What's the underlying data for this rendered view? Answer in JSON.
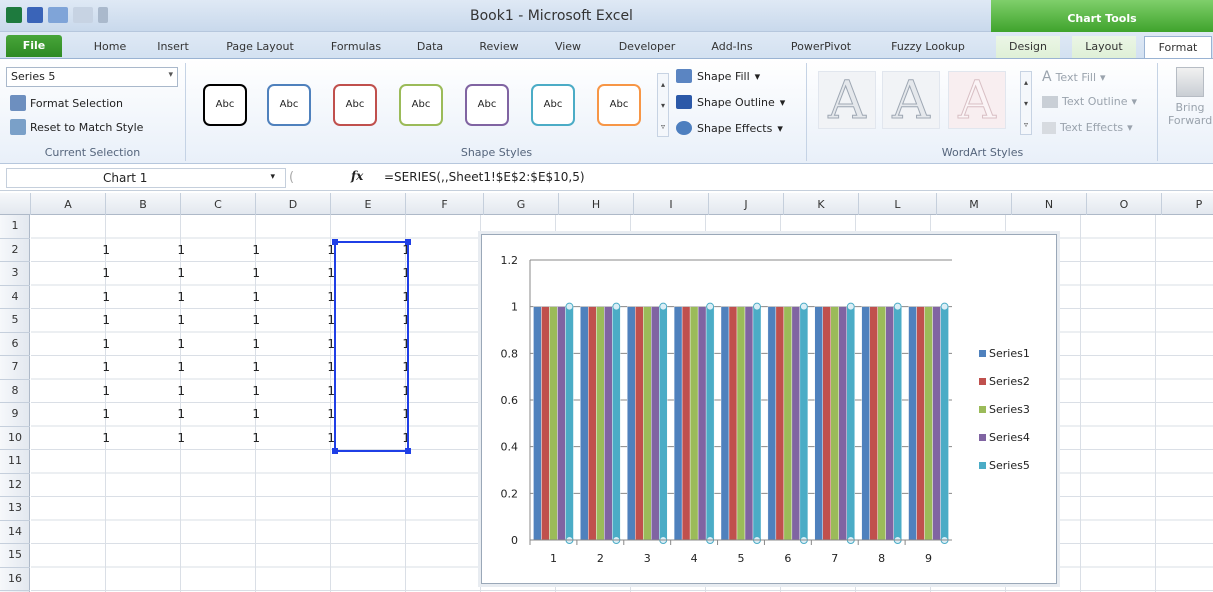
{
  "window": {
    "title": "Book1 - Microsoft Excel",
    "context_tab_group": "Chart Tools"
  },
  "tabs": [
    {
      "label": "File"
    },
    {
      "label": "Home"
    },
    {
      "label": "Insert"
    },
    {
      "label": "Page Layout"
    },
    {
      "label": "Formulas"
    },
    {
      "label": "Data"
    },
    {
      "label": "Review"
    },
    {
      "label": "View"
    },
    {
      "label": "Developer"
    },
    {
      "label": "Add-Ins"
    },
    {
      "label": "PowerPivot"
    },
    {
      "label": "Fuzzy Lookup"
    },
    {
      "label": "Design"
    },
    {
      "label": "Layout"
    },
    {
      "label": "Format"
    }
  ],
  "ribbon": {
    "current_selection": {
      "selected": "Series 5",
      "format_selection": "Format Selection",
      "reset": "Reset to Match Style",
      "group_label": "Current Selection"
    },
    "shape_styles": {
      "swatches": [
        {
          "label": "Abc",
          "color": "#000000"
        },
        {
          "label": "Abc",
          "color": "#4f81bd"
        },
        {
          "label": "Abc",
          "color": "#c0504d"
        },
        {
          "label": "Abc",
          "color": "#9bbb59"
        },
        {
          "label": "Abc",
          "color": "#8064a2"
        },
        {
          "label": "Abc",
          "color": "#4bacc6"
        },
        {
          "label": "Abc",
          "color": "#f79646"
        }
      ],
      "shape_fill": "Shape Fill",
      "shape_outline": "Shape Outline",
      "shape_effects": "Shape Effects",
      "group_label": "Shape Styles"
    },
    "wordart": {
      "glyph": "A",
      "text_fill": "Text Fill",
      "text_outline": "Text Outline",
      "text_effects": "Text Effects",
      "group_label": "WordArt Styles"
    },
    "arrange": {
      "bring_forward_1": "Bring",
      "bring_forward_2": "Forward"
    }
  },
  "formula_bar": {
    "name_box": "Chart 1",
    "fx": "fx",
    "formula": "=SERIES(,,Sheet1!$E$2:$E$10,5)"
  },
  "columns": [
    "A",
    "B",
    "C",
    "D",
    "E",
    "F",
    "G",
    "H",
    "I",
    "J",
    "K",
    "L",
    "M",
    "N",
    "O",
    "P"
  ],
  "rows": [
    "1",
    "2",
    "3",
    "4",
    "5",
    "6",
    "7",
    "8",
    "9",
    "10",
    "11",
    "12",
    "13",
    "14",
    "15",
    "16"
  ],
  "cell_value": "1",
  "chart_data": {
    "type": "bar",
    "categories": [
      "1",
      "2",
      "3",
      "4",
      "5",
      "6",
      "7",
      "8",
      "9"
    ],
    "series": [
      {
        "name": "Series1",
        "color": "#4f81bd",
        "values": [
          1,
          1,
          1,
          1,
          1,
          1,
          1,
          1,
          1
        ]
      },
      {
        "name": "Series2",
        "color": "#c0504d",
        "values": [
          1,
          1,
          1,
          1,
          1,
          1,
          1,
          1,
          1
        ]
      },
      {
        "name": "Series3",
        "color": "#9bbb59",
        "values": [
          1,
          1,
          1,
          1,
          1,
          1,
          1,
          1,
          1
        ]
      },
      {
        "name": "Series4",
        "color": "#8064a2",
        "values": [
          1,
          1,
          1,
          1,
          1,
          1,
          1,
          1,
          1
        ]
      },
      {
        "name": "Series5",
        "color": "#4bacc6",
        "values": [
          1,
          1,
          1,
          1,
          1,
          1,
          1,
          1,
          1
        ]
      }
    ],
    "yticks": [
      "0",
      "0.2",
      "0.4",
      "0.6",
      "0.8",
      "1",
      "1.2"
    ],
    "ylim": [
      0,
      1.2
    ],
    "grid": true,
    "legend": "right",
    "selected_series": "Series5"
  }
}
